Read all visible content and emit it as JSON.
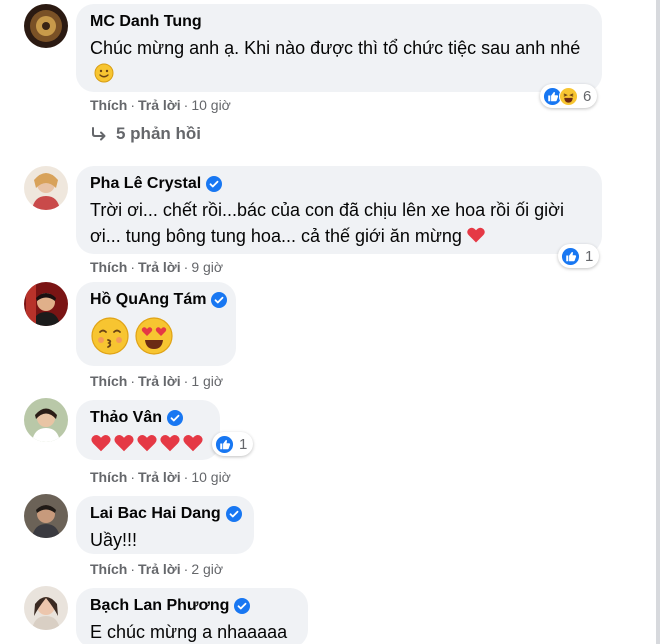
{
  "comments": [
    {
      "author": "MC Danh Tung",
      "verified": false,
      "text": "Chúc mừng anh ạ. Khi nào được thì tổ chức tiệc sau anh nhé",
      "inline_emoji": "slightly-smiling-face",
      "like_label": "Thích",
      "reply_label": "Trả lời",
      "time": "10 giờ",
      "reaction_icons": [
        "like-reaction",
        "haha-reaction"
      ],
      "reaction_count": "6",
      "replies_label": "5 phản hồi"
    },
    {
      "author": "Pha Lê Crystal",
      "verified": true,
      "text": "Trời ơi... chết rồi...bác của con đã chịu lên xe hoa rồi ối giời ơi... tung bông tung hoa... cả thế giới ăn mừng",
      "inline_emoji": "red-heart",
      "like_label": "Thích",
      "reply_label": "Trả lời",
      "time": "9 giờ",
      "reaction_icons": [
        "like-reaction"
      ],
      "reaction_count": "1"
    },
    {
      "author": "Hồ QuAng Tám",
      "verified": true,
      "emojis": [
        "kissing-face",
        "heart-eyes-face"
      ],
      "like_label": "Thích",
      "reply_label": "Trả lời",
      "time": "1 giờ"
    },
    {
      "author": "Thảo Vân",
      "verified": true,
      "hearts": 5,
      "like_label": "Thích",
      "reply_label": "Trả lời",
      "time": "10 giờ",
      "reaction_icons": [
        "like-reaction"
      ],
      "reaction_count": "1"
    },
    {
      "author": "Lai Bac Hai Dang",
      "verified": true,
      "text": "Uầy!!!",
      "like_label": "Thích",
      "reply_label": "Trả lời",
      "time": "2 giờ"
    },
    {
      "author": "Bạch Lan Phương",
      "verified": true,
      "text": "E chúc mừng a nhaaaaa"
    }
  ],
  "colors": {
    "bubble": "#f0f2f5",
    "meta": "#65676b",
    "verified": "#1877f2",
    "like": "#1877f2",
    "heart": "#f0284a"
  }
}
